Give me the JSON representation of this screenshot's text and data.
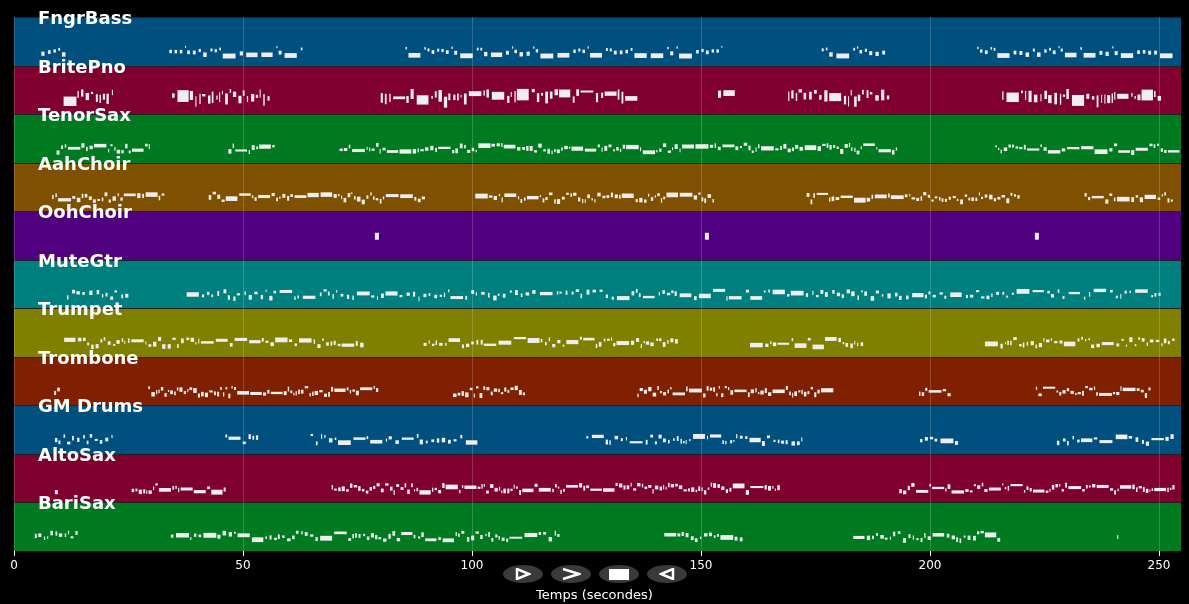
{
  "tracks": [
    {
      "name": "FngrBass",
      "color": "#00507f"
    },
    {
      "name": "BritePno",
      "color": "#7f002f"
    },
    {
      "name": "TenorSax",
      "color": "#007a20"
    },
    {
      "name": "AahChoir",
      "color": "#7f5000"
    },
    {
      "name": "OohChoir",
      "color": "#50007f"
    },
    {
      "name": "MuteGtr",
      "color": "#007f7f"
    },
    {
      "name": "Trumpet",
      "color": "#7f7f00"
    },
    {
      "name": "Trombone",
      "color": "#7f2000"
    },
    {
      "name": "GM Drums",
      "color": "#00507f"
    },
    {
      "name": "AltoSax",
      "color": "#7f002f"
    },
    {
      "name": "BariSax",
      "color": "#007a20"
    }
  ],
  "x_axis": {
    "label": "Temps (secondes)",
    "ticks": [
      "0",
      "50",
      "100",
      "150",
      "200",
      "250"
    ]
  },
  "controls": [
    {
      "kind": "play"
    },
    {
      "kind": "forward"
    },
    {
      "kind": "stop"
    },
    {
      "kind": "rewind"
    }
  ]
}
